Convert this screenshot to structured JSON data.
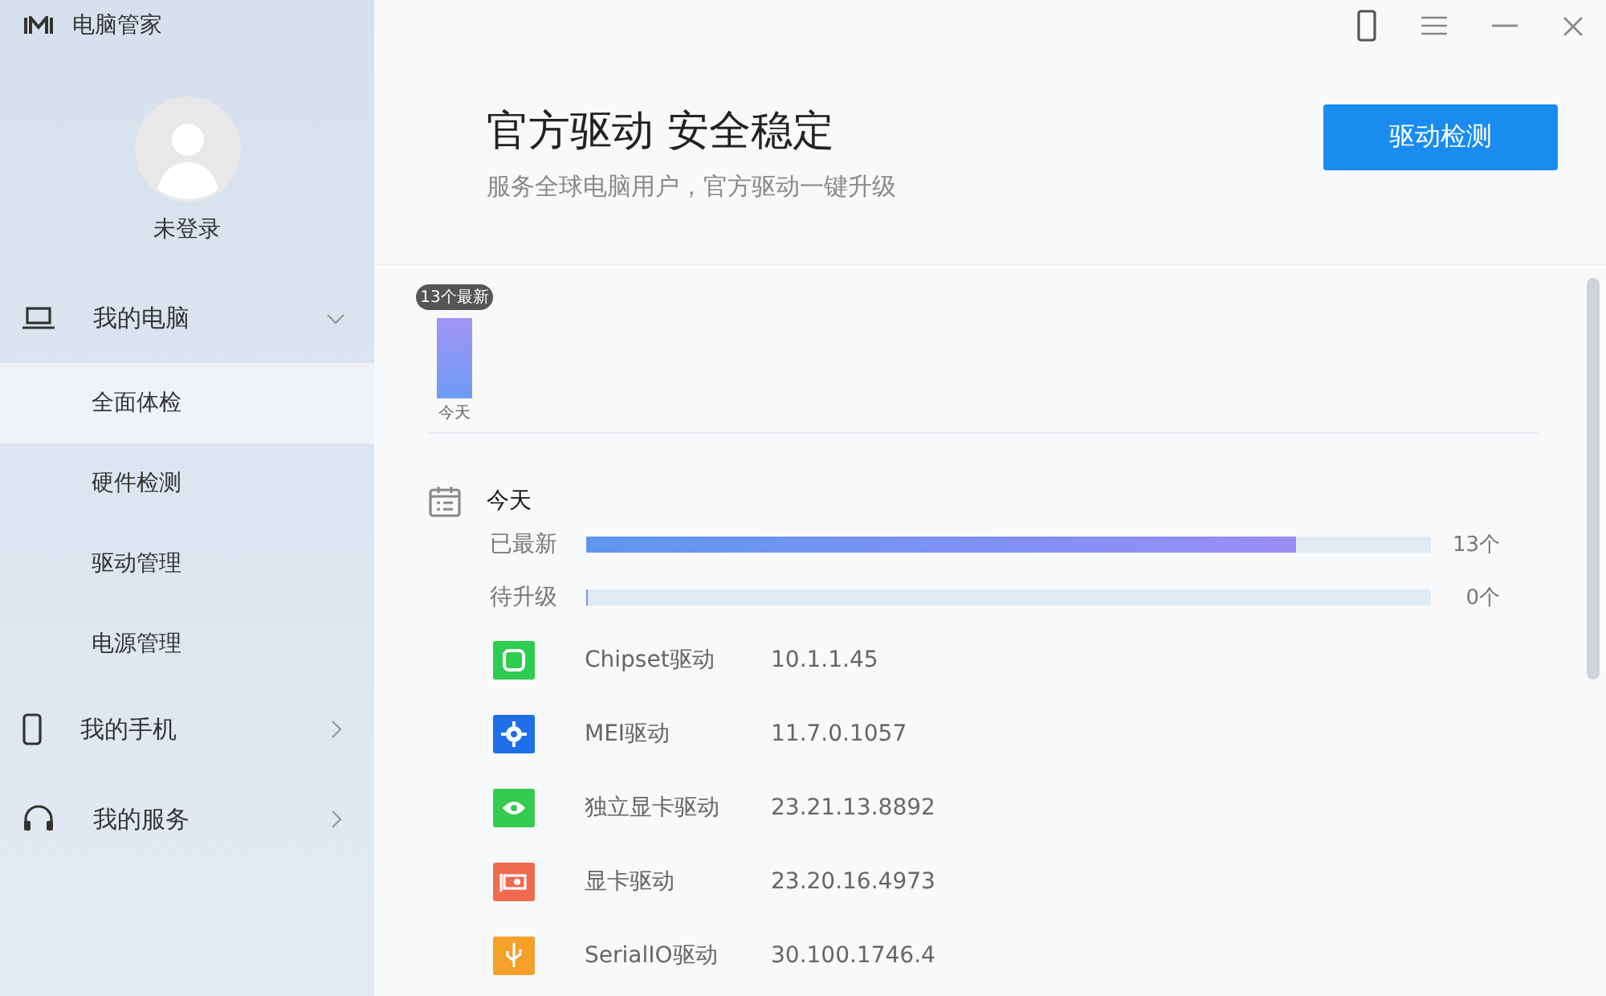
{
  "app": {
    "title": "电脑管家"
  },
  "user": {
    "name": "未登录"
  },
  "sidebar": {
    "items": [
      {
        "kind": "laptop",
        "label": "我的电脑",
        "expanded": true,
        "children": [
          {
            "label": "全面体检",
            "selected": true
          },
          {
            "label": "硬件检测",
            "selected": false
          },
          {
            "label": "驱动管理",
            "selected": false
          },
          {
            "label": "电源管理",
            "selected": false
          }
        ]
      },
      {
        "kind": "phone",
        "label": "我的手机",
        "expanded": false
      },
      {
        "kind": "headset",
        "label": "我的服务",
        "expanded": false
      }
    ]
  },
  "header": {
    "title": "官方驱动 安全稳定",
    "subtitle": "服务全球电脑用户，官方驱动一键升级",
    "button": "驱动检测"
  },
  "history": {
    "tooltip": "13个最新",
    "label": "今天"
  },
  "summary": {
    "date": "今天",
    "bars": [
      {
        "label": "已最新",
        "level": 0.84,
        "count": "13个"
      },
      {
        "label": "待升级",
        "level": 0,
        "count": "0个"
      }
    ]
  },
  "drivers": [
    {
      "kind": "chip",
      "color": "#2ecc4f",
      "name": "Chipset驱动",
      "version": "10.1.1.45"
    },
    {
      "kind": "gear",
      "color": "#1f6fe8",
      "name": "MEI驱动",
      "version": "11.7.0.1057"
    },
    {
      "kind": "eye",
      "color": "#33cc4f",
      "name": "独立显卡驱动",
      "version": "23.21.13.8892"
    },
    {
      "kind": "card",
      "color": "#f06a4f",
      "name": "显卡驱动",
      "version": "23.20.16.4973"
    },
    {
      "kind": "usb",
      "color": "#f5a029",
      "name": "SerialIO驱动",
      "version": "30.100.1746.4"
    }
  ]
}
